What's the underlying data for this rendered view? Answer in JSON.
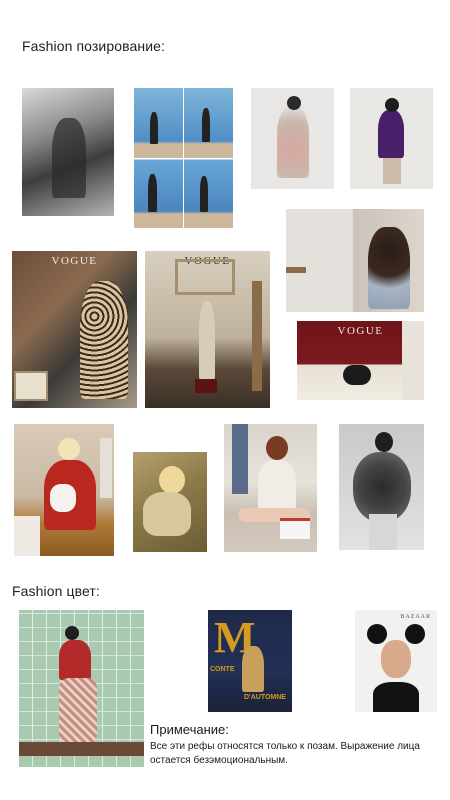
{
  "sections": {
    "posing_title": "Fashion позирование:",
    "color_title": "Fashion цвет:"
  },
  "posing_images": [
    {
      "name": "bw-lying-pose-photo",
      "caption": ""
    },
    {
      "name": "poolside-four-poses-photo",
      "caption": ""
    },
    {
      "name": "fur-seated-model-photo",
      "caption": ""
    },
    {
      "name": "purple-fringe-model-photo",
      "caption": ""
    },
    {
      "name": "curly-hair-window-photo",
      "caption": ""
    },
    {
      "name": "vogue-leopard-coat-cover",
      "caption": "VOGUE"
    },
    {
      "name": "vogue-atelier-cover",
      "caption": "VOGUE"
    },
    {
      "name": "vogue-red-curtain-cover",
      "caption": "VOGUE"
    },
    {
      "name": "red-sweater-seated-photo",
      "caption": ""
    },
    {
      "name": "blonde-sofa-photo",
      "caption": ""
    },
    {
      "name": "floor-sitting-socks-photo",
      "caption": ""
    },
    {
      "name": "bw-dried-flowers-photo",
      "caption": ""
    }
  ],
  "color_images": [
    {
      "name": "green-tile-wall-photo",
      "caption": ""
    },
    {
      "name": "m-magazine-cover",
      "caption": "M",
      "line1": "CONTE",
      "line2": "D'AUTOMNE"
    },
    {
      "name": "bazaar-mouse-ears-cover",
      "caption": "BAZAAR"
    }
  ],
  "note": {
    "title": "Примечание:",
    "body": "Все эти рефы относятся только к позам. Выражение лица остается безэмоциональным."
  },
  "palette": {
    "background": "#ffffff",
    "text": "#1a1a1a",
    "magazine_accent": "#d59a1f"
  }
}
